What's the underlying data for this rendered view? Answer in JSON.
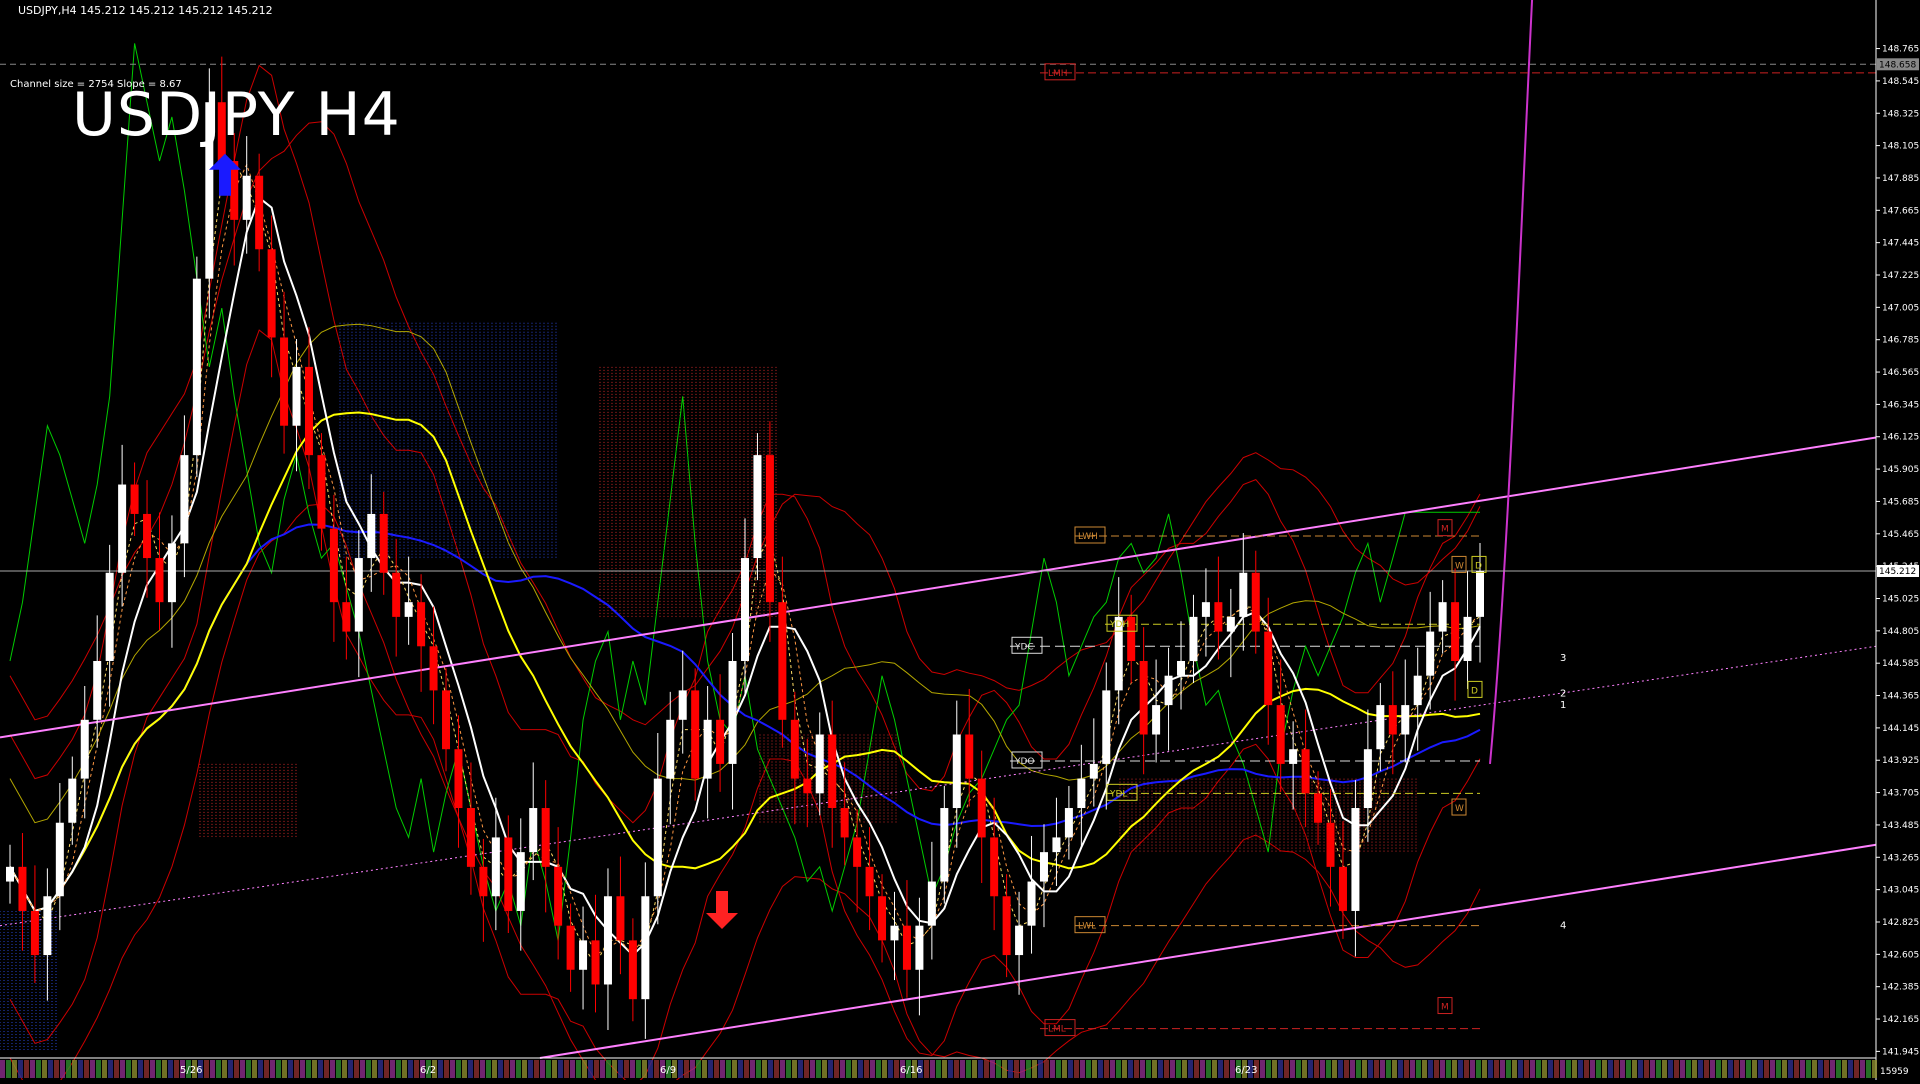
{
  "header": {
    "symbol_info": "USDJPY,H4  145.212 145.212 145.212 145.212",
    "title": "USDJPY H4",
    "channel_info": "Channel size = 2754 Slope = 8.67"
  },
  "colors": {
    "background": "#000000",
    "bull_candle": "#ffffff",
    "bear_candle": "#ff0000",
    "channel_line": "#ff80ff",
    "ma_white": "#ffffff",
    "ma_yellow": "#ffff00",
    "ma_blue": "#1a1aff",
    "envelope_red": "#cc0000",
    "chikou_green": "#00cc00",
    "cloud_edge": "#b3a600",
    "purple_curve": "#cc33cc",
    "axis": "#ffffff"
  },
  "chart_data": {
    "type": "candlestick",
    "symbol": "USDJPY",
    "timeframe": "H4",
    "current_price": "145.212",
    "top_level_label": "148.658",
    "bottom_label": "15959",
    "ylim": [
      141.9,
      149.0
    ],
    "y_ticks": [
      "148.765",
      "148.545",
      "148.325",
      "148.105",
      "147.885",
      "147.665",
      "147.445",
      "147.225",
      "147.005",
      "146.785",
      "146.565",
      "146.345",
      "146.125",
      "145.905",
      "145.685",
      "145.465",
      "145.245",
      "145.025",
      "144.805",
      "144.585",
      "144.365",
      "144.145",
      "143.925",
      "143.705",
      "143.485",
      "143.265",
      "143.045",
      "142.825",
      "142.605",
      "142.385",
      "142.165",
      "141.945"
    ],
    "x_labels": [
      "5/26",
      "6/2",
      "6/9",
      "6/16",
      "6/23"
    ],
    "level_labels": [
      "LMH",
      "LWH",
      "YDH",
      "YDC",
      "YDO",
      "YDL",
      "LWL",
      "LML",
      "W",
      "D",
      "M"
    ],
    "wave_labels": [
      "1",
      "2",
      "3",
      "4"
    ],
    "closes": [
      143.2,
      142.9,
      142.6,
      143.0,
      143.5,
      143.8,
      144.2,
      144.6,
      145.2,
      145.8,
      145.6,
      145.3,
      145.0,
      145.4,
      146.0,
      147.2,
      148.4,
      148.0,
      147.6,
      147.9,
      147.4,
      146.8,
      146.2,
      146.6,
      146.0,
      145.5,
      145.0,
      144.8,
      145.3,
      145.6,
      145.2,
      144.9,
      145.0,
      144.7,
      144.4,
      144.0,
      143.6,
      143.2,
      143.0,
      143.4,
      142.9,
      143.3,
      143.6,
      143.2,
      142.8,
      142.5,
      142.7,
      142.4,
      143.0,
      142.7,
      142.3,
      143.0,
      143.8,
      144.2,
      144.4,
      143.8,
      144.2,
      143.9,
      144.6,
      145.3,
      146.0,
      145.0,
      144.2,
      143.8,
      143.7,
      144.1,
      143.6,
      143.4,
      143.2,
      143.0,
      142.7,
      142.8,
      142.5,
      142.8,
      143.1,
      143.6,
      144.1,
      143.8,
      143.4,
      143.0,
      142.6,
      142.8,
      143.1,
      143.3,
      143.4,
      143.6,
      143.8,
      143.9,
      144.4,
      144.9,
      144.6,
      144.1,
      144.3,
      144.5,
      144.6,
      144.9,
      145.0,
      144.8,
      144.9,
      145.2,
      144.8,
      144.3,
      143.9,
      144.0,
      143.7,
      143.5,
      143.2,
      142.9,
      143.6,
      144.0,
      144.3,
      144.1,
      144.3,
      144.5,
      144.8,
      145.0,
      144.6,
      144.9,
      145.212
    ]
  }
}
